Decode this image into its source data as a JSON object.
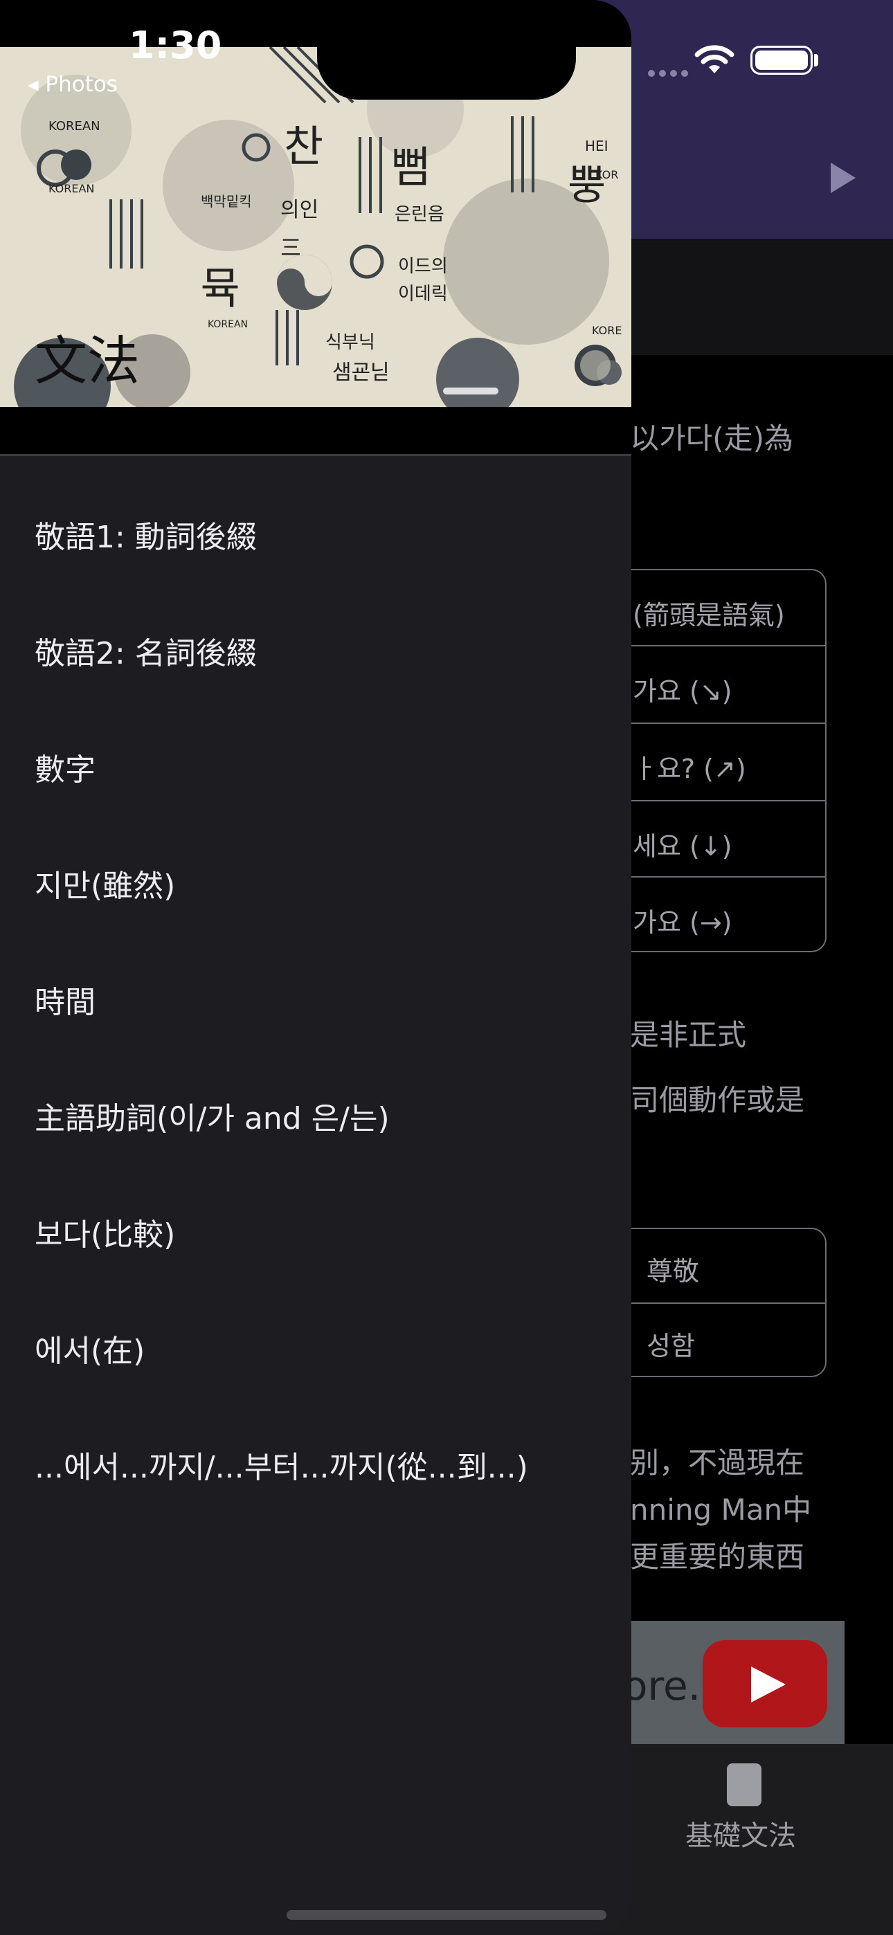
{
  "status_bar": {
    "time": "1:30",
    "back_label": "◂ Photos"
  },
  "drawer": {
    "title": "文法",
    "items": [
      "敬語1: 動詞後綴",
      "敬語2: 名詞後綴",
      "數字",
      "지만(雖然)",
      "時間",
      "主語助詞(이/가 and 은/는)",
      "보다(比較)",
      "에서(在)",
      "...에서...까지/...부터...까지(從...到...)"
    ]
  },
  "background": {
    "line1": "以가다(走)為",
    "table1": [
      "(箭頭是語氣)",
      "가요 (↘)",
      "ㅏ요? (↗)",
      "세요 (↓)",
      "가요 (→)"
    ],
    "line2": "是非正式",
    "line3": "司個動作或是",
    "table2": [
      "尊敬",
      "성함"
    ],
    "para": [
      "别，不過現在",
      "nning Man中",
      "更重要的東西"
    ],
    "video_text": "ore.",
    "tab_label": "基礎文法"
  },
  "colors": {
    "header": "#2f2651",
    "drawer": "#1d1c21"
  }
}
